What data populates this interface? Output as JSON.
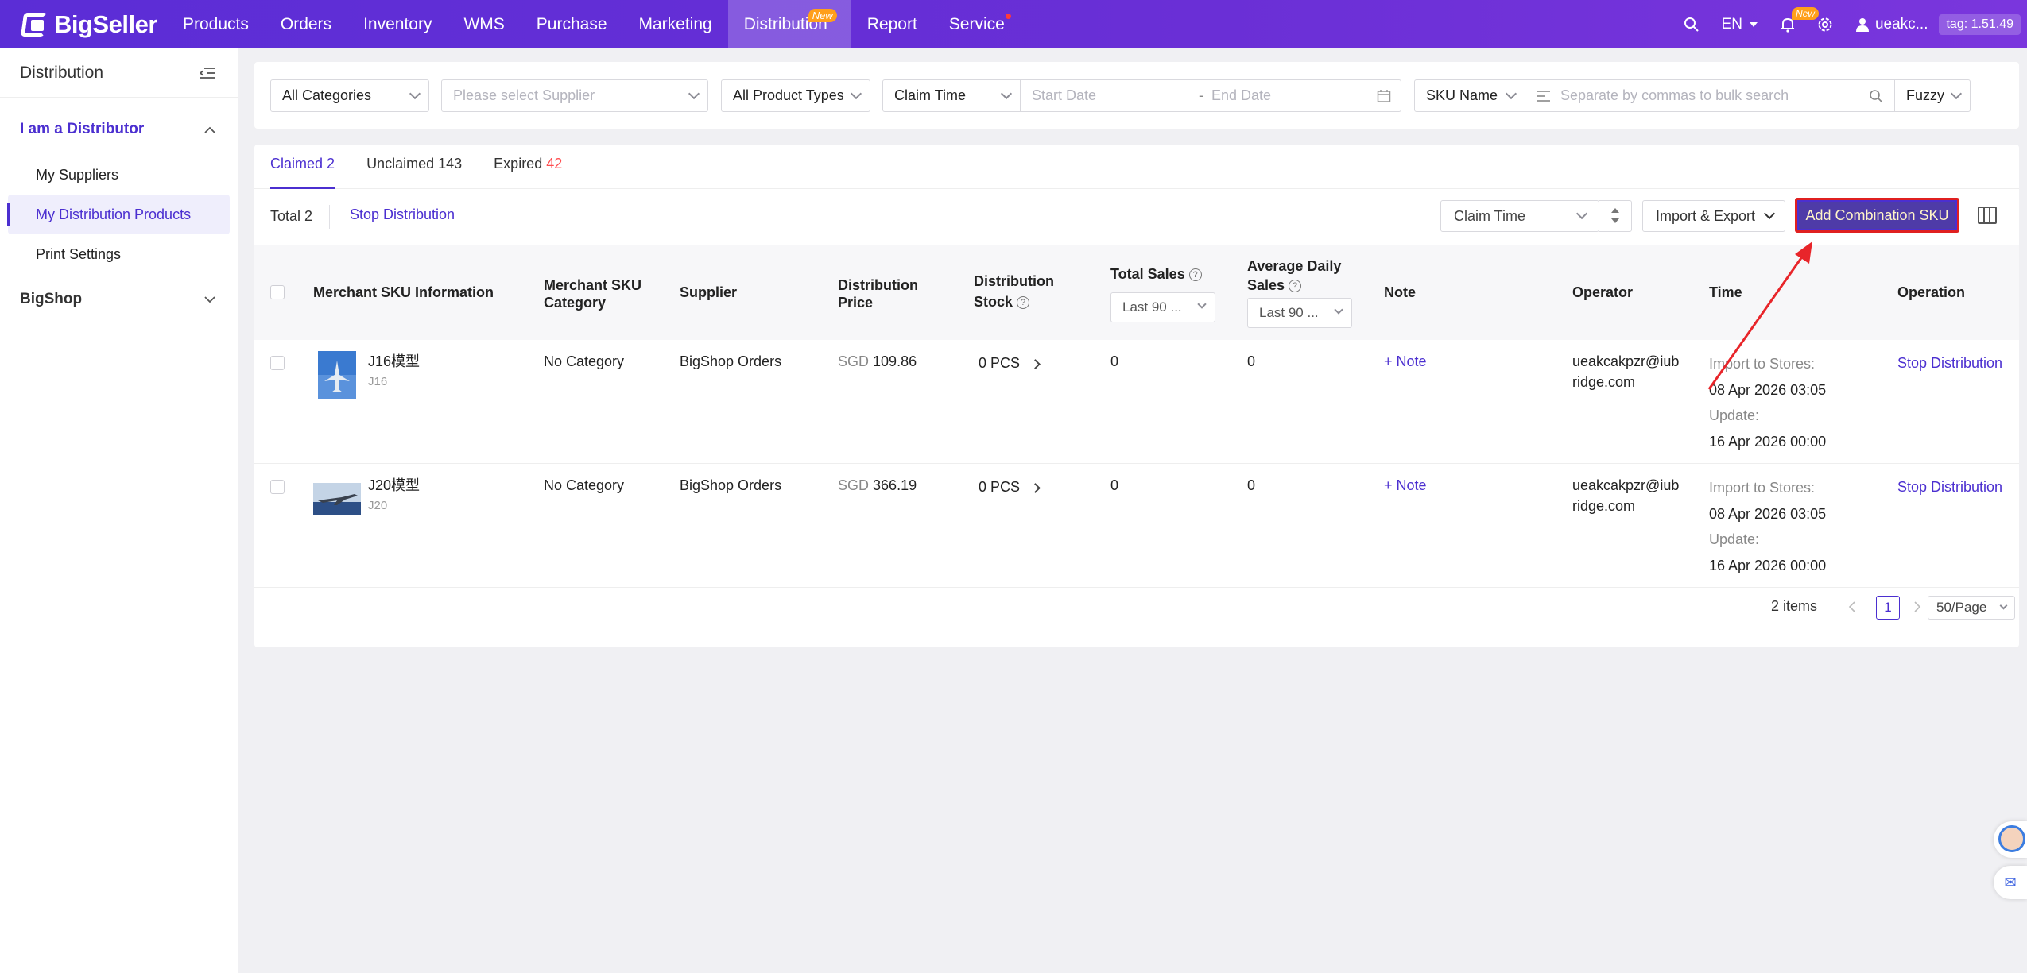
{
  "nav": {
    "logo": "BigSeller",
    "items": [
      "Products",
      "Orders",
      "Inventory",
      "WMS",
      "Purchase",
      "Marketing",
      "Distribution",
      "Report",
      "Service"
    ],
    "distribution_badge": "New",
    "lang": "EN",
    "bell_badge": "New",
    "user": "ueakc...",
    "tag": "tag: 1.51.49"
  },
  "sidebar": {
    "title": "Distribution",
    "section1": "I am a Distributor",
    "items": [
      "My Suppliers",
      "My Distribution Products",
      "Print Settings"
    ],
    "section2": "BigShop"
  },
  "filters": {
    "category": "All Categories",
    "supplier_placeholder": "Please select Supplier",
    "product_types": "All Product Types",
    "time_type": "Claim Time",
    "start_placeholder": "Start Date",
    "end_placeholder": "End Date",
    "search_field": "SKU Name",
    "search_placeholder": "Separate by commas to bulk search",
    "match_mode": "Fuzzy"
  },
  "tabs": {
    "claimed": "Claimed",
    "claimed_count": "2",
    "unclaimed": "Unclaimed",
    "unclaimed_count": "143",
    "expired": "Expired",
    "expired_count": "42"
  },
  "toolbar": {
    "total": "Total 2",
    "stop_distribution": "Stop Distribution",
    "sort": "Claim Time",
    "import_export": "Import & Export",
    "add_combination": "Add Combination SKU"
  },
  "columns": {
    "sku_info": "Merchant SKU Information",
    "sku_category_1": "Merchant SKU",
    "sku_category_2": "Category",
    "supplier": "Supplier",
    "price_1": "Distribution",
    "price_2": "Price",
    "stock_1": "Distribution",
    "stock_2": "Stock",
    "total_sales": "Total Sales",
    "total_sales_period": "Last 90 ...",
    "avg_sales_1": "Average Daily",
    "avg_sales_2": "Sales",
    "avg_sales_period": "Last 90 ...",
    "note": "Note",
    "operator": "Operator",
    "time": "Time",
    "operation": "Operation"
  },
  "rows": [
    {
      "name": "J16模型",
      "sku": "J16",
      "category": "No Category",
      "supplier": "BigShop Orders",
      "currency": "SGD",
      "price": "109.86",
      "stock": "0 PCS",
      "total_sales": "0",
      "avg_sales": "0",
      "note": "+ Note",
      "operator_1": "ueakcakpzr@iub",
      "operator_2": "ridge.com",
      "import_label": "Import to Stores:",
      "import_time": "08 Apr 2026 03:05",
      "update_label": "Update:",
      "update_time": "16 Apr 2026 00:00",
      "operation": "Stop Distribution"
    },
    {
      "name": "J20模型",
      "sku": "J20",
      "category": "No Category",
      "supplier": "BigShop Orders",
      "currency": "SGD",
      "price": "366.19",
      "stock": "0 PCS",
      "total_sales": "0",
      "avg_sales": "0",
      "note": "+ Note",
      "operator_1": "ueakcakpzr@iub",
      "operator_2": "ridge.com",
      "import_label": "Import to Stores:",
      "import_time": "08 Apr 2026 03:05",
      "update_label": "Update:",
      "update_time": "16 Apr 2026 00:00",
      "operation": "Stop Distribution"
    }
  ],
  "pagination": {
    "items": "2 items",
    "current": "1",
    "page_size": "50/Page"
  }
}
